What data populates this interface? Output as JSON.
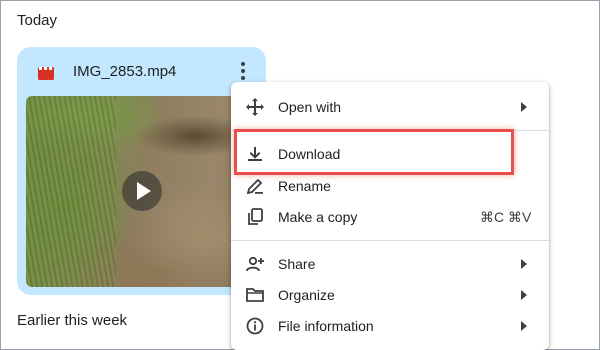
{
  "sections": {
    "today": "Today",
    "earlier": "Earlier this week"
  },
  "file": {
    "name": "IMG_2853.mp4",
    "type_icon": "video-file-icon",
    "accent": "#c2e7ff",
    "icon_color": "#d93025"
  },
  "context_menu": {
    "items": [
      {
        "label": "Open with",
        "icon": "move-arrows-icon",
        "submenu": true
      },
      {
        "label": "Download",
        "icon": "download-icon",
        "submenu": false,
        "highlighted": true
      },
      {
        "label": "Rename",
        "icon": "pencil-icon",
        "submenu": false
      },
      {
        "label": "Make a copy",
        "icon": "copy-icon",
        "submenu": false,
        "shortcut": "⌘C ⌘V"
      },
      {
        "label": "Share",
        "icon": "person-add-icon",
        "submenu": true
      },
      {
        "label": "Organize",
        "icon": "folder-icon",
        "submenu": true
      },
      {
        "label": "File information",
        "icon": "info-icon",
        "submenu": true
      }
    ]
  },
  "colors": {
    "highlight_border": "#e8514a"
  }
}
